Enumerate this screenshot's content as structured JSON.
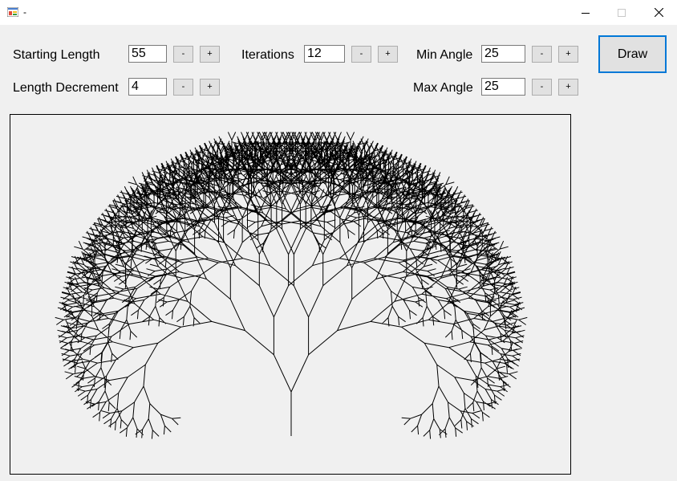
{
  "window": {
    "title": "-",
    "minimize_icon": "minimize-icon",
    "maximize_icon": "maximize-icon",
    "close_icon": "close-icon"
  },
  "controls": {
    "starting_length": {
      "label": "Starting Length",
      "value": "55",
      "dec": "-",
      "inc": "+"
    },
    "length_decrement": {
      "label": "Length Decrement",
      "value": "4",
      "dec": "-",
      "inc": "+"
    },
    "iterations": {
      "label": "Iterations",
      "value": "12",
      "dec": "-",
      "inc": "+"
    },
    "min_angle": {
      "label": "Min Angle",
      "value": "25",
      "dec": "-",
      "inc": "+"
    },
    "max_angle": {
      "label": "Max Angle",
      "value": "25",
      "dec": "-",
      "inc": "+"
    }
  },
  "draw_button": {
    "label": "Draw"
  },
  "colors": {
    "accent": "#0078d7",
    "tree_stroke": "#000000",
    "window_bg": "#f0f0f0"
  }
}
